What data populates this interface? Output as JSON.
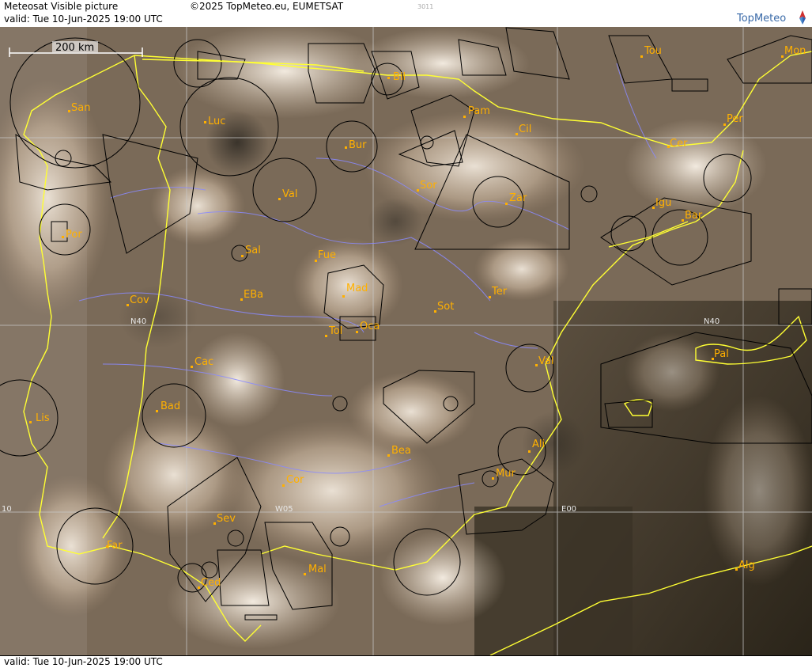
{
  "header": {
    "title": "Meteosat Visible picture",
    "valid": "valid:  Tue  10-Jun-2025  19:00 UTC",
    "copyright": "©2025 TopMeteo.eu, EUMETSAT",
    "code": "3011",
    "brand": "TopMeteo"
  },
  "scale": {
    "label": "200 km"
  },
  "grid_labels": {
    "n40_west": "N40",
    "n40_east": "N40",
    "w10": "10",
    "w05": "W05",
    "e00": "E00"
  },
  "cities": {
    "san": "San",
    "luc": "Luc",
    "bil": "Bil",
    "pam": "Pam",
    "cil": "Cil",
    "tou": "Tou",
    "mon": "Mon",
    "per": "Per",
    "cer": "Cer",
    "bur": "Bur",
    "val_n": "Val",
    "sor": "Sor",
    "zar": "Zar",
    "igu": "Igu",
    "bar": "Bar",
    "por": "Por",
    "sal": "Sal",
    "fue": "Fue",
    "mad": "Mad",
    "cov": "Cov",
    "eba": "EBa",
    "sot": "Sot",
    "ter": "Ter",
    "tol": "Tol",
    "oca": "Oca",
    "val_e": "Val",
    "pal": "Pal",
    "cac": "Cac",
    "bad": "Bad",
    "lis": "Lis",
    "ali": "Ali",
    "bea": "Bea",
    "mur": "Mur",
    "cor": "Cor",
    "sev": "Sev",
    "far": "Far",
    "mal": "Mal",
    "ced": "Ced",
    "alg": "Alg"
  },
  "colors": {
    "coast": "#ffff33",
    "rivers": "#8a8aff",
    "city": "#ffb000",
    "airspace": "#000000",
    "grid": "#c8c8c8"
  }
}
